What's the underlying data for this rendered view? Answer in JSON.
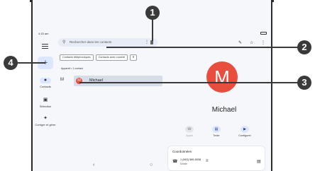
{
  "status_bar": {
    "time": "4:15 am"
  },
  "rail": {
    "fab_label": "+",
    "items": [
      {
        "label": "Contacts",
        "icon": "person-icon",
        "active": true
      },
      {
        "label": "Sélection",
        "icon": "bookmark-icon",
        "active": false
      },
      {
        "label": "Corriger et gérer",
        "icon": "wrench-icon",
        "active": false
      }
    ]
  },
  "search": {
    "placeholder": "Rechercher dans les contacts"
  },
  "chips": [
    "Contacts téléphoniques",
    "Contacts avec courriel",
    "Ⅱ"
  ],
  "account": "Appareil • 1 contact",
  "section_letter": "M",
  "contact": {
    "initial": "M",
    "name": "Michael"
  },
  "detail": {
    "initial": "M",
    "name": "Michael",
    "actions": [
      {
        "label": "Appel",
        "icon": "phone-icon",
        "enabled": false
      },
      {
        "label": "Texte",
        "icon": "message-icon",
        "enabled": true
      },
      {
        "label": "Configurer",
        "icon": "video-icon",
        "enabled": true
      }
    ],
    "card_title": "Coordonnées",
    "phone_number": "1 (563) 589-6538",
    "phone_type": "Mobile"
  },
  "callouts": [
    "1",
    "2",
    "3",
    "4"
  ],
  "colors": {
    "avatar": "#e84d3d",
    "accent": "#dce6ff",
    "callout": "#3a3a3a"
  }
}
